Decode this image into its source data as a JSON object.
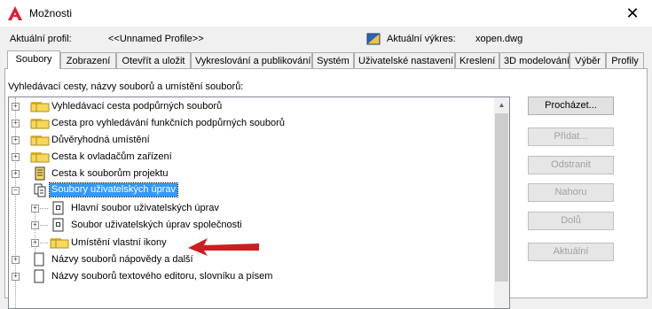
{
  "window": {
    "title": "Možnosti",
    "close_glyph": "✕"
  },
  "profile": {
    "current_profile_label": "Aktuální profil:",
    "current_profile_value": "<<Unnamed Profile>>",
    "current_drawing_label": "Aktuální výkres:",
    "current_drawing_value": "xopen.dwg"
  },
  "tabs": [
    {
      "label": "Soubory",
      "active": true
    },
    {
      "label": "Zobrazení"
    },
    {
      "label": "Otevřít a uložit"
    },
    {
      "label": "Vykreslování a publikování"
    },
    {
      "label": "Systém"
    },
    {
      "label": "Uživatelské nastavení"
    },
    {
      "label": "Kreslení"
    },
    {
      "label": "3D modelování"
    },
    {
      "label": "Výběr"
    },
    {
      "label": "Profily"
    }
  ],
  "files": {
    "heading": "Vyhledávací cesty, názvy souborů a umístění souborů:",
    "tree": [
      {
        "label": "Vyhledávací cesta podpůrných souborů",
        "icon": "folder-icon",
        "expander": "+"
      },
      {
        "label": "Cesta pro vyhledávání funkčních podpůrných souborů",
        "icon": "folder-icon",
        "expander": "+"
      },
      {
        "label": "Důvěryhodná umístění",
        "icon": "folder-icon",
        "expander": "+"
      },
      {
        "label": "Cesta k ovladačům zařízení",
        "icon": "folder-icon",
        "expander": "+"
      },
      {
        "label": "Cesta k souborům projektu",
        "icon": "project-file-icon",
        "expander": "+"
      },
      {
        "label": "Soubory uživatelských úprav",
        "icon": "customization-files-icon",
        "expander": "−",
        "selected": true
      },
      {
        "label": "Hlavní soubor uživatelských úprav",
        "icon": "cui-file-icon",
        "expander": "+"
      },
      {
        "label": "Soubor uživatelských úprav společnosti",
        "icon": "cui-file-icon",
        "expander": "+"
      },
      {
        "label": "Umístění vlastní ikony",
        "icon": "folder-icon",
        "expander": "+"
      },
      {
        "label": "Názvy souborů nápovědy a další",
        "icon": "document-icon",
        "expander": "+"
      },
      {
        "label": "Názvy souborů textového editoru, slovníku a písem",
        "icon": "document-icon",
        "expander": "+"
      }
    ]
  },
  "buttons": {
    "browse": "Procházet...",
    "add": "Přidat...",
    "remove": "Odstranit",
    "up": "Nahoru",
    "down": "Dolů",
    "current": "Aktuální"
  },
  "colors": {
    "selection": "#3399ff",
    "annotation_arrow": "#cc1f1f",
    "folder_yellow": "#f7d85c"
  }
}
